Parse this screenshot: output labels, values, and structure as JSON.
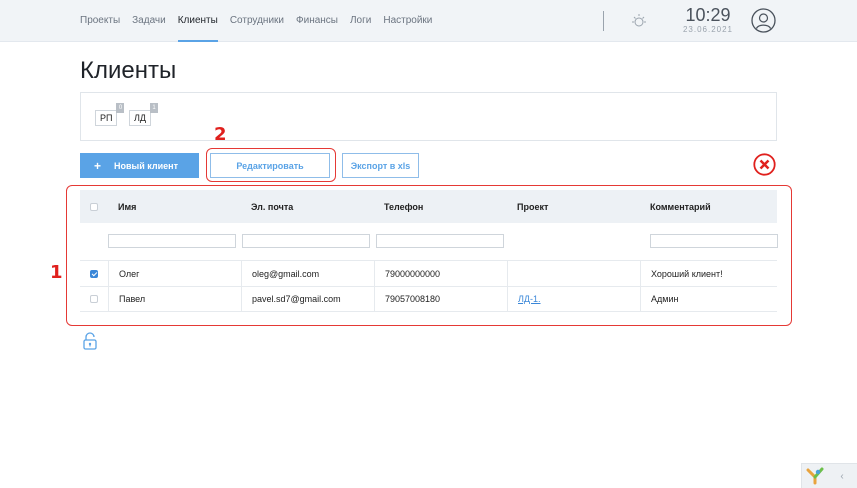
{
  "nav": {
    "items": [
      "Проекты",
      "Задачи",
      "Клиенты",
      "Сотрудники",
      "Финансы",
      "Логи",
      "Настройки"
    ],
    "active_index": 2
  },
  "header": {
    "time": "10:29",
    "date": "23.06.2021",
    "icons": [
      "sun-icon",
      "user-avatar-icon"
    ]
  },
  "page": {
    "title": "Клиенты"
  },
  "tags": [
    {
      "label": "РП",
      "count": "0"
    },
    {
      "label": "ЛД",
      "count": "1"
    }
  ],
  "actions": {
    "new_client": "Новый клиент",
    "new_client_icon": "+",
    "edit": "Редактировать",
    "export": "Экспорт в xls",
    "delete_icon": "close-circle-icon"
  },
  "annotations": {
    "table": "1",
    "edit": "2"
  },
  "table": {
    "columns": [
      "Имя",
      "Эл. почта",
      "Телефон",
      "Проект",
      "Комментарий"
    ],
    "rows": [
      {
        "checked": true,
        "name": "Олег",
        "email": "oleg@gmail.com",
        "phone": "79000000000",
        "project": "",
        "comment": "Хороший клиент!"
      },
      {
        "checked": false,
        "name": "Павел",
        "email": "pavel.sd7@gmail.com",
        "phone": "79057008180",
        "project": "ЛД-1.",
        "comment": "Админ"
      }
    ]
  },
  "footer": {
    "toggle_arrow": "‹"
  },
  "colors": {
    "accent": "#5aa3e6",
    "annotation": "#e53935",
    "link": "#3a87d8"
  }
}
